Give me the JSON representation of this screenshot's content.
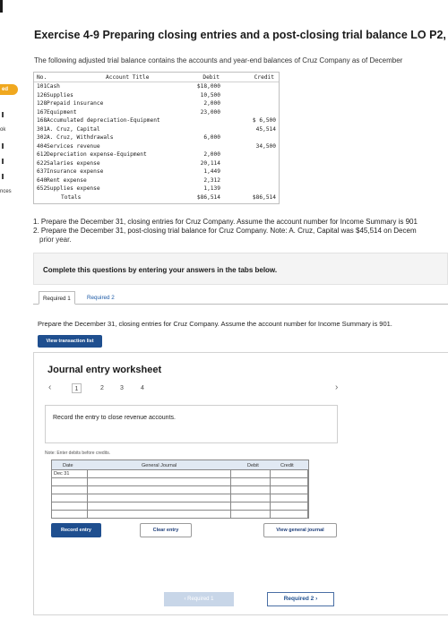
{
  "exercise": {
    "title": "Exercise 4-9 Preparing closing entries and a post-closing trial balance LO P2, P3",
    "intro": "The following adjusted trial balance contains the accounts and year-end balances of Cruz Company as of December"
  },
  "left_rail": {
    "highlight_label": "ed",
    "mid_label": "ok",
    "bottom_label": "nces"
  },
  "trial_balance": {
    "headers": {
      "no": "No.",
      "account": "Account Title",
      "debit": "Debit",
      "credit": "Credit"
    },
    "rows": [
      {
        "no": "101",
        "account": "Cash",
        "debit": "$18,000",
        "credit": ""
      },
      {
        "no": "126",
        "account": "Supplies",
        "debit": "10,500",
        "credit": ""
      },
      {
        "no": "128",
        "account": "Prepaid insurance",
        "debit": "2,000",
        "credit": ""
      },
      {
        "no": "167",
        "account": "Equipment",
        "debit": "23,000",
        "credit": ""
      },
      {
        "no": "168",
        "account": "Accumulated depreciation-Equipment",
        "debit": "",
        "credit": "$ 6,500"
      },
      {
        "no": "301",
        "account": "A. Cruz, Capital",
        "debit": "",
        "credit": "45,514"
      },
      {
        "no": "302",
        "account": "A. Cruz, Withdrawals",
        "debit": "6,000",
        "credit": ""
      },
      {
        "no": "404",
        "account": "Services revenue",
        "debit": "",
        "credit": "34,500"
      },
      {
        "no": "612",
        "account": "Depreciation expense-Equipment",
        "debit": "2,000",
        "credit": ""
      },
      {
        "no": "622",
        "account": "Salaries expense",
        "debit": "20,114",
        "credit": ""
      },
      {
        "no": "637",
        "account": "Insurance expense",
        "debit": "1,449",
        "credit": ""
      },
      {
        "no": "640",
        "account": "Rent expense",
        "debit": "2,312",
        "credit": ""
      },
      {
        "no": "652",
        "account": "Supplies expense",
        "debit": "1,139",
        "credit": ""
      },
      {
        "no": "",
        "account": "Totals",
        "debit": "$86,514",
        "credit": "$86,514"
      }
    ]
  },
  "instructions": {
    "line1": "1. Prepare the December 31, closing entries for Cruz Company. Assume the account number for Income Summary is 901",
    "line2": "2. Prepare the December 31, post-closing trial balance for Cruz Company. Note: A. Cruz, Capital was $45,514 on Decem",
    "line3": "prior year."
  },
  "question_banner": "Complete this questions by entering your answers in the tabs below.",
  "tabs": [
    {
      "label": "Required 1",
      "active": true
    },
    {
      "label": "Required 2",
      "active": false
    }
  ],
  "prompt": "Prepare the December 31, closing entries for Cruz Company. Assume the account number for Income Summary is 901.",
  "view_transaction_list": "View transaction list",
  "worksheet": {
    "title": "Journal entry worksheet",
    "pages": [
      "1",
      "2",
      "3",
      "4"
    ],
    "current_page": "1",
    "entry_text": "Record the entry to close revenue accounts.",
    "note": "Note: Enter debits before credits.",
    "columns": {
      "date": "Date",
      "account": "General Journal",
      "debit": "Debit",
      "credit": "Credit"
    },
    "first_date": "Dec 31",
    "row_count": 6
  },
  "buttons": {
    "record_entry": "Record entry",
    "clear_entry": "Clear entry",
    "view_general_journal": "View general journal"
  },
  "nav": {
    "prev": "Required 1",
    "next": "Required 2"
  }
}
